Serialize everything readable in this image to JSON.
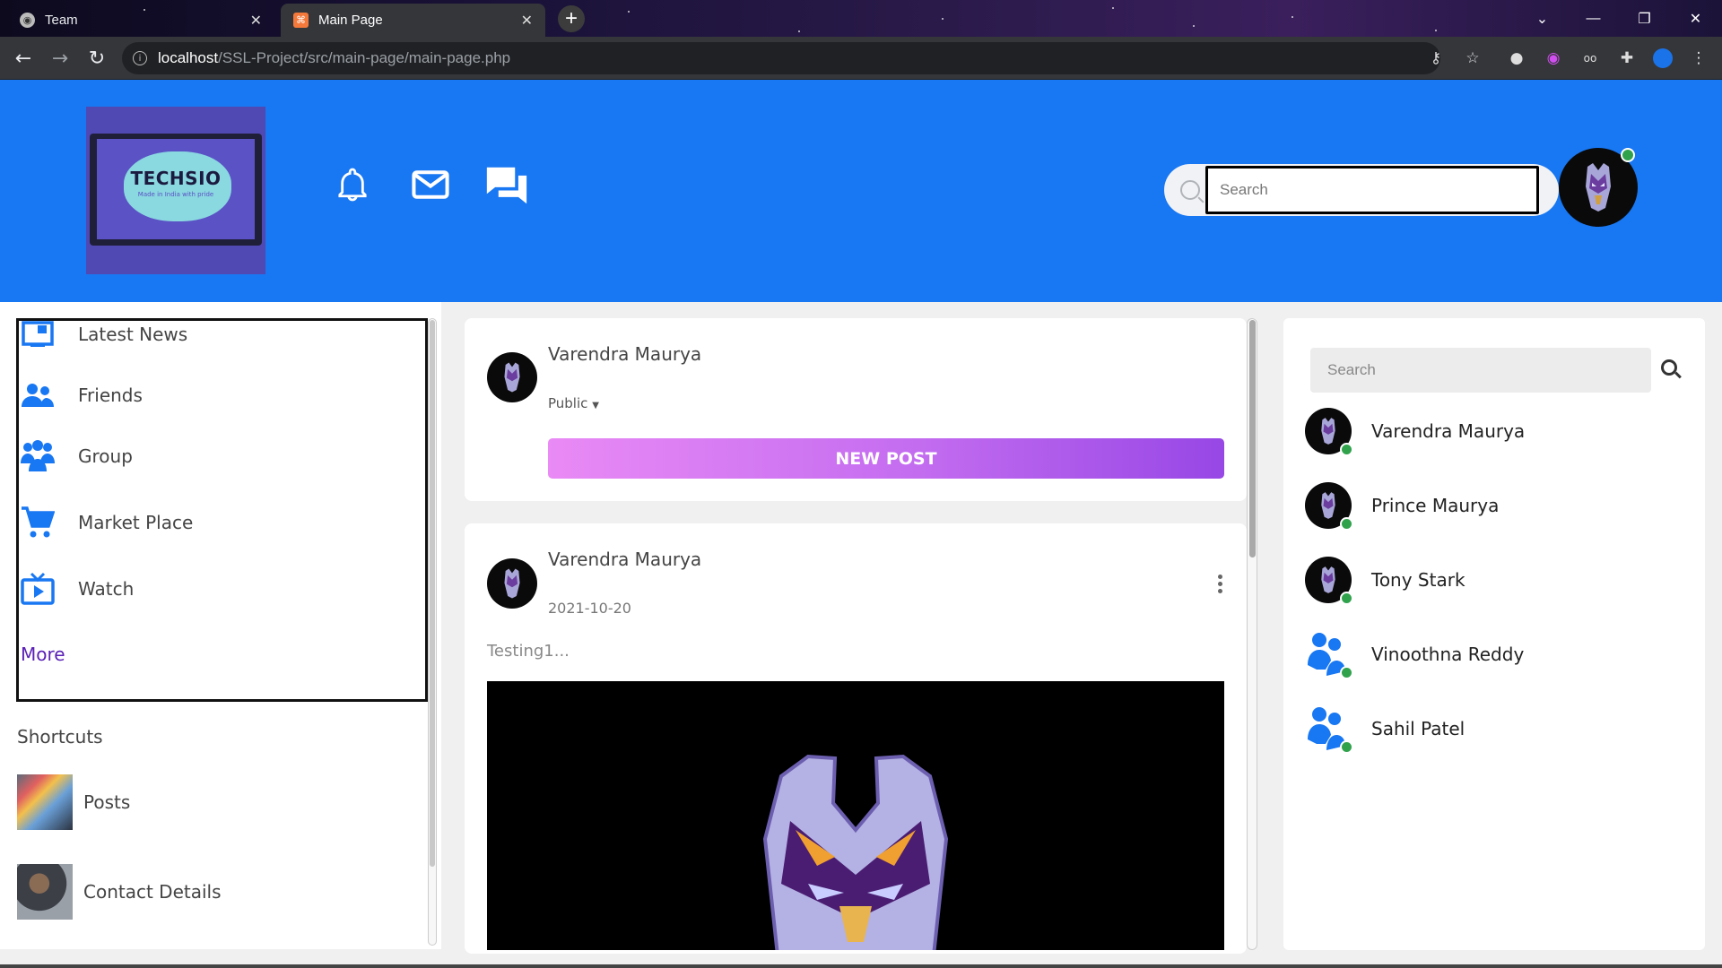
{
  "browser": {
    "tabs": [
      {
        "title": "Team",
        "active": false
      },
      {
        "title": "Main Page",
        "active": true
      }
    ],
    "url_host": "localhost",
    "url_path": "/SSL-Project/src/main-page/main-page.php",
    "window_controls": [
      "chevron-down-icon",
      "minimize-icon",
      "restore-icon",
      "close-icon"
    ],
    "extensions": [
      "key-icon",
      "star-icon",
      "extension-1-icon",
      "extension-2-icon",
      "extension-3-icon",
      "puzzle-icon",
      "profile-icon",
      "menu-icon"
    ]
  },
  "header": {
    "logo": {
      "title": "TECHSIO",
      "subtitle": "Made in India with pride"
    },
    "icons": [
      "bell-icon",
      "mail-icon",
      "chat-icon"
    ],
    "search": {
      "placeholder": "Search",
      "value": ""
    },
    "user_online": true
  },
  "sidebar": {
    "items": [
      {
        "label": "Latest News",
        "icon": "news-icon"
      },
      {
        "label": "Friends",
        "icon": "friends-icon"
      },
      {
        "label": "Group",
        "icon": "group-icon"
      },
      {
        "label": "Market Place",
        "icon": "cart-icon"
      },
      {
        "label": "Watch",
        "icon": "tv-icon"
      }
    ],
    "more_label": "More",
    "shortcuts_title": "Shortcuts",
    "shortcuts": [
      {
        "label": "Posts"
      },
      {
        "label": "Contact Details"
      }
    ]
  },
  "composer": {
    "user": "Varendra Maurya",
    "privacy": "Public",
    "button_label": "NEW POST"
  },
  "post": {
    "user": "Varendra Maurya",
    "date": "2021-10-20",
    "text": "Testing1..."
  },
  "contacts": {
    "search_placeholder": "Search",
    "list": [
      {
        "name": "Varendra Maurya",
        "avatar": "robot",
        "online": true
      },
      {
        "name": "Prince Maurya",
        "avatar": "robot",
        "online": true
      },
      {
        "name": "Tony Stark",
        "avatar": "robot",
        "online": true
      },
      {
        "name": "Vinoothna Reddy",
        "avatar": "people",
        "online": true
      },
      {
        "name": "Sahil Patel",
        "avatar": "people",
        "online": true
      }
    ]
  },
  "colors": {
    "brand": "#1877f2",
    "online": "#31a24c",
    "more_link": "#5b21b6"
  }
}
